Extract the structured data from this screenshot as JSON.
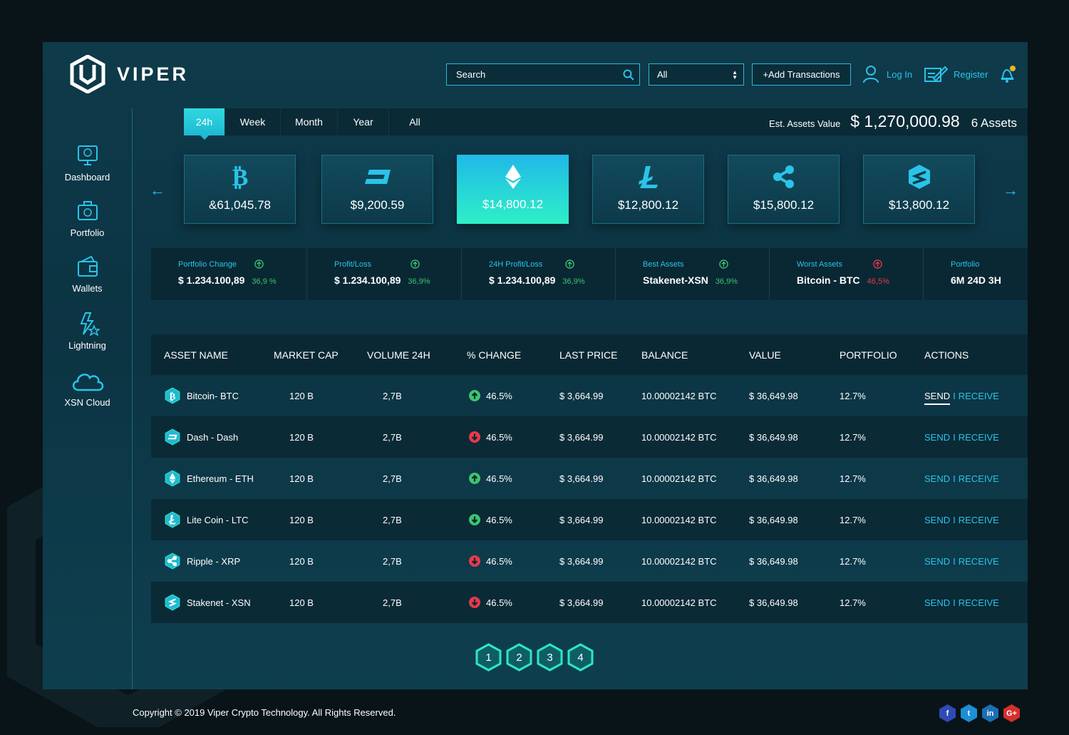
{
  "brand": {
    "name": "VIPER"
  },
  "header": {
    "search_placeholder": "Search",
    "filter_value": "All",
    "add_transactions": "+Add Transactions",
    "login": "Log In",
    "register": "Register"
  },
  "sidebar": {
    "items": [
      {
        "label": "Dashboard",
        "icon": "dashboard-icon"
      },
      {
        "label": "Portfolio",
        "icon": "portfolio-icon"
      },
      {
        "label": "Wallets",
        "icon": "wallet-icon"
      },
      {
        "label": "Lightning",
        "icon": "lightning-icon"
      },
      {
        "label": "XSN Cloud",
        "icon": "cloud-icon"
      }
    ]
  },
  "tabs": [
    "24h",
    "Week",
    "Month",
    "Year",
    "All"
  ],
  "active_tab": "24h",
  "estimate": {
    "label": "Est. Assets Value",
    "value": "$ 1,270,000.98",
    "count": "6 Assets"
  },
  "coins": [
    {
      "value": "&61,045.78",
      "icon": "bitcoin-icon"
    },
    {
      "value": "$9,200.59",
      "icon": "dash-icon"
    },
    {
      "value": "$14,800.12",
      "icon": "ethereum-icon",
      "active": true
    },
    {
      "value": "$12,800.12",
      "icon": "litecoin-icon"
    },
    {
      "value": "$15,800.12",
      "icon": "ripple-icon"
    },
    {
      "value": "$13,800.12",
      "icon": "stakenet-icon"
    }
  ],
  "stats": [
    {
      "label": "Portfolio Change",
      "value": "$ 1.234.100,89",
      "pct": "36,9 %",
      "trend": "up"
    },
    {
      "label": "Profit/Loss",
      "value": "$ 1.234.100,89",
      "pct": "36,9%",
      "trend": "up"
    },
    {
      "label": "24H Profit/Loss",
      "value": "$ 1.234.100,89",
      "pct": "36,9%",
      "trend": "up"
    },
    {
      "label": "Best Assets",
      "value": "Stakenet-XSN",
      "pct": "36,9%",
      "trend": "up"
    },
    {
      "label": "Worst Assets",
      "value": "Bitcoin - BTC",
      "pct": "46,5%",
      "trend": "down"
    },
    {
      "label": "Portfolio",
      "value": "6M 24D 3H",
      "pct": "",
      "trend": ""
    }
  ],
  "table": {
    "headers": [
      "ASSET NAME",
      "MARKET CAP",
      "VOLUME 24H",
      "% CHANGE",
      "LAST PRICE",
      "BALANCE",
      "VALUE",
      "PORTFOLIO",
      "ACTIONS"
    ],
    "rows": [
      {
        "name": "Bitcoin- BTC",
        "icon": "bitcoin-icon",
        "cap": "120 B",
        "vol": "2,7B",
        "change": "46.5%",
        "trend": "up",
        "price": "$ 3,664.99",
        "balance": "10.00002142 BTC",
        "value": "$ 36,649.98",
        "portfolio": "12.7%"
      },
      {
        "name": "Dash - Dash",
        "icon": "dash-icon",
        "cap": "120 B",
        "vol": "2,7B",
        "change": "46.5%",
        "trend": "down",
        "price": "$ 3,664.99",
        "balance": "10.00002142 BTC",
        "value": "$ 36,649.98",
        "portfolio": "12.7%"
      },
      {
        "name": "Ethereum - ETH",
        "icon": "ethereum-icon",
        "cap": "120 B",
        "vol": "2,7B",
        "change": "46.5%",
        "trend": "up",
        "price": "$ 3,664.99",
        "balance": "10.00002142 BTC",
        "value": "$ 36,649.98",
        "portfolio": "12.7%"
      },
      {
        "name": "Lite Coin - LTC",
        "icon": "litecoin-icon",
        "cap": "120 B",
        "vol": "2,7B",
        "change": "46.5%",
        "trend": "downgreen",
        "price": "$ 3,664.99",
        "balance": "10.00002142 BTC",
        "value": "$ 36,649.98",
        "portfolio": "12.7%"
      },
      {
        "name": "Ripple - XRP",
        "icon": "ripple-icon",
        "cap": "120 B",
        "vol": "2,7B",
        "change": "46.5%",
        "trend": "down",
        "price": "$ 3,664.99",
        "balance": "10.00002142 BTC",
        "value": "$ 36,649.98",
        "portfolio": "12.7%"
      },
      {
        "name": "Stakenet - XSN",
        "icon": "stakenet-icon",
        "cap": "120 B",
        "vol": "2,7B",
        "change": "46.5%",
        "trend": "down",
        "price": "$ 3,664.99",
        "balance": "10.00002142 BTC",
        "value": "$ 36,649.98",
        "portfolio": "12.7%"
      }
    ],
    "send": "SEND",
    "separator": "I",
    "receive": "RECEIVE"
  },
  "pagination": [
    "1",
    "2",
    "3",
    "4"
  ],
  "footer": {
    "copyright": "Copyright © 2019 Viper Crypto Technology. All Rights Reserved.",
    "socials": [
      {
        "label": "f",
        "color": "#2f49b6"
      },
      {
        "label": "t",
        "color": "#1d8fd6"
      },
      {
        "label": "in",
        "color": "#1a6fb5"
      },
      {
        "label": "G+",
        "color": "#d5302c"
      }
    ]
  },
  "colors": {
    "accent": "#2bc3e8",
    "up": "#3ec46d",
    "down": "#e8394a"
  }
}
